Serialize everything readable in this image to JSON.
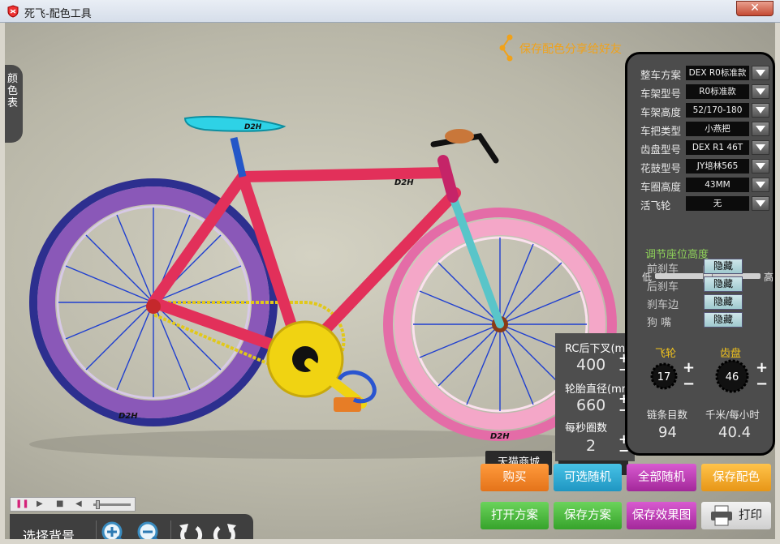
{
  "window": {
    "title": "死飞-配色工具",
    "close_label": "✕"
  },
  "color_tab": {
    "label": "颜色表"
  },
  "share": {
    "label": "保存配色分享给好友"
  },
  "options": [
    {
      "label": "整车方案",
      "value": "DEX R0标准款"
    },
    {
      "label": "车架型号",
      "value": "R0标准款"
    },
    {
      "label": "车架高度",
      "value": "52/170-180"
    },
    {
      "label": "车把类型",
      "value": "小燕把"
    },
    {
      "label": "齿盘型号",
      "value": "DEX R1 46T"
    },
    {
      "label": "花鼓型号",
      "value": "JY培林565"
    },
    {
      "label": "车圈高度",
      "value": "43MM"
    },
    {
      "label": "活飞轮",
      "value": "无"
    }
  ],
  "seat": {
    "title": "调节座位高度",
    "low": "低",
    "high": "高",
    "level": 0.5
  },
  "hide_rows": [
    {
      "label": "前刹车",
      "button": "隐藏"
    },
    {
      "label": "后刹车",
      "button": "隐藏"
    },
    {
      "label": "刹车边",
      "button": "隐藏"
    },
    {
      "label": "狗 嘴",
      "button": "隐藏"
    }
  ],
  "gear": {
    "freewheel_label": "飞轮",
    "freewheel_value": "17",
    "chainring_label": "齿盘",
    "chainring_value": "46",
    "plus": "+",
    "minus": "−",
    "chain_label": "链条目数",
    "chain_value": "94",
    "speed_label": "千米/每小时",
    "speed_value": "40.4"
  },
  "numeric": {
    "rc_label": "RC后下叉(mm)",
    "rc_value": "400",
    "tire_label": "轮胎直径(mm)",
    "tire_value": "660",
    "rps_label": "每秒圈数",
    "rps_value": "2"
  },
  "tmall": {
    "label": "天猫商城"
  },
  "buttons": {
    "buy": "购买",
    "optional_random": "可选随机",
    "all_random": "全部随机",
    "save_color": "保存配色",
    "open_plan": "打开方案",
    "save_plan": "保存方案",
    "save_effect": "保存效果图",
    "print": "打印"
  },
  "toolbar": {
    "bg_label": "选择背景"
  },
  "colors": {
    "accent_green": "#8fd35a",
    "gear_yellow": "#f3c41c",
    "share_orange": "#f0a21a"
  }
}
